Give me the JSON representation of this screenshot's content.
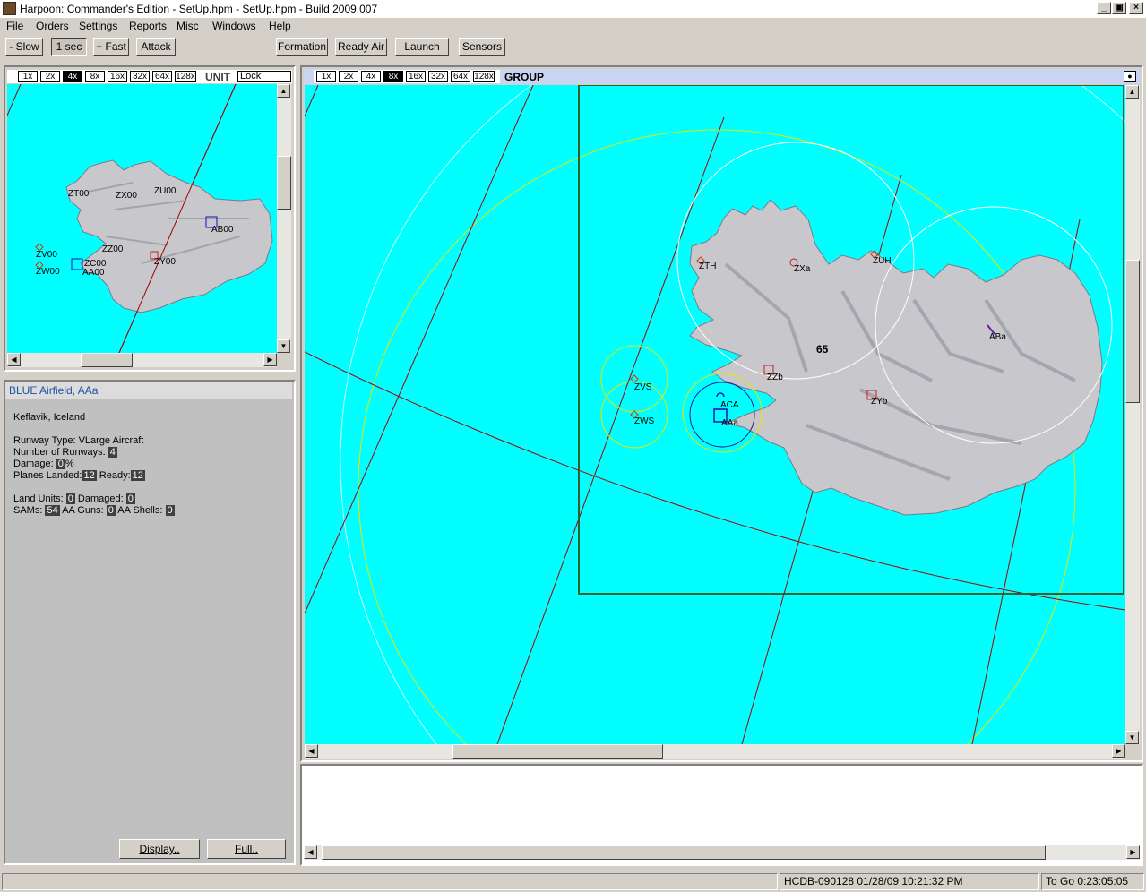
{
  "window": {
    "title": "Harpoon: Commander's Edition - SetUp.hpm - SetUp.hpm - Build 2009.007",
    "controls": [
      "_",
      "▣",
      "×"
    ]
  },
  "menu": [
    "File",
    "Orders",
    "Settings",
    "Reports",
    "Misc",
    "Windows",
    "Help"
  ],
  "toolbar": {
    "slow": "- Slow",
    "time": "1 sec",
    "fast": "+ Fast",
    "attack": "Attack",
    "formation": "Formation",
    "ready_air": "Ready Air",
    "launch": "Launch",
    "sensors": "Sensors"
  },
  "zoom_levels": [
    "1x",
    "2x",
    "4x",
    "8x",
    "16x",
    "32x",
    "64x",
    "128x"
  ],
  "unit_map": {
    "selected_zoom": "4x",
    "label": "UNIT",
    "lock_value": "Lock",
    "markers": [
      "ZT00",
      "ZX00",
      "ZU00",
      "AB00",
      "ZZ00",
      "ZV00",
      "ZW00",
      "ZC00",
      "AA00",
      "ZY00"
    ]
  },
  "group_map": {
    "selected_zoom": "8x",
    "label": "GROUP",
    "markers": [
      "ZTH",
      "ZXa",
      "ZUH",
      "ABa",
      "65",
      "ZZb",
      "ZYb",
      "ZVS",
      "ZWS",
      "ACA",
      "AAa"
    ]
  },
  "info": {
    "header": "BLUE Airfield, AAa",
    "location": "Keflavik, Iceland",
    "runway_type_label": "Runway Type:",
    "runway_type": "VLarge Aircraft",
    "num_runways_label": "Number of Runways:",
    "num_runways": "4",
    "damage_label": "Damage:",
    "damage": "0",
    "damage_unit": "%",
    "planes_landed_label": "Planes Landed:",
    "planes_landed": "12",
    "ready_label": "Ready:",
    "ready": "12",
    "land_units_label": "Land Units:",
    "land_units": "0",
    "damaged_label": "Damaged:",
    "damaged": "0",
    "sams_label": "SAMs:",
    "sams": "54",
    "aa_guns_label": "AA Guns:",
    "aa_guns": "0",
    "aa_shells_label": "AA Shells:",
    "aa_shells": "0",
    "display_button": "Display..",
    "full_button": "Full.."
  },
  "status": {
    "db": "HCDB-090128 01/28/09 10:21:32 PM",
    "to_go": "To Go 0:23:05:05"
  },
  "colors": {
    "sea": "#00ffff",
    "land": "#c8c8cc",
    "grid_line": "#a00000",
    "range_ring_yellow": "#e6e600",
    "range_ring_white": "#ffffff",
    "blue_unit": "#1010c0",
    "red_unit": "#c02020"
  }
}
